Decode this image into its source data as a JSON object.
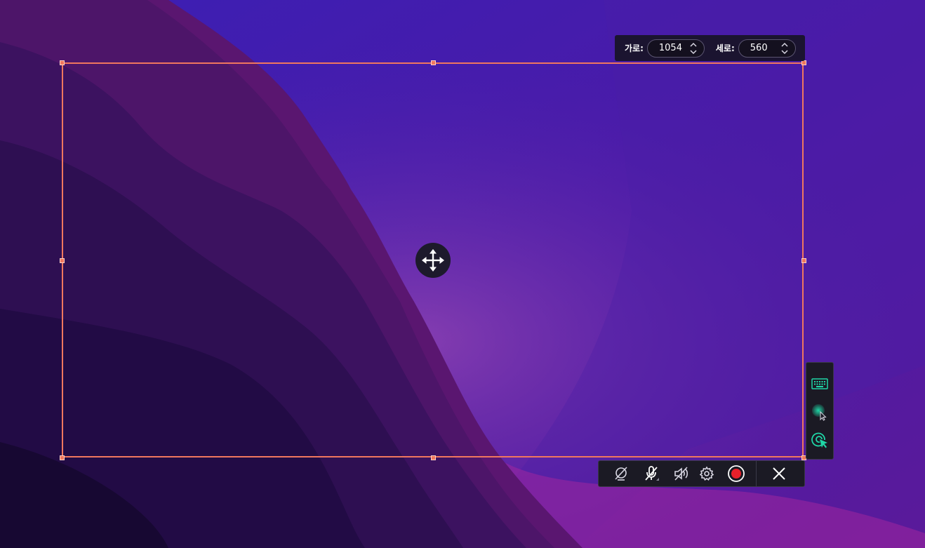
{
  "dimensions": {
    "width_label": "가로:",
    "width_value": "1054",
    "height_label": "세로:",
    "height_value": "560"
  },
  "icons": {
    "move": "move-arrows-icon",
    "webcam_off": "webcam-off-icon",
    "mic_off": "microphone-off-icon",
    "speaker_off": "speaker-off-icon",
    "settings": "gear-icon",
    "record": "record-icon",
    "close": "close-icon",
    "keyboard": "keyboard-icon",
    "cursor_highlight": "cursor-highlight-icon",
    "click_effect": "click-effect-icon"
  },
  "colors": {
    "selection": "#f0775e",
    "record": "#e8202a",
    "accent": "#1fd6a6"
  }
}
